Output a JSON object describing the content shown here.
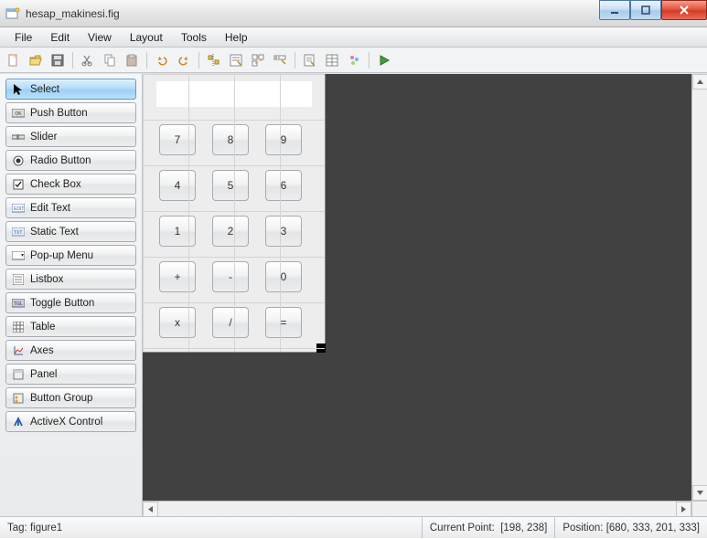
{
  "window": {
    "title": "hesap_makinesi.fig"
  },
  "menus": {
    "file": "File",
    "edit": "Edit",
    "view": "View",
    "layout": "Layout",
    "tools": "Tools",
    "help": "Help"
  },
  "palette": [
    {
      "id": "select",
      "label": "Select"
    },
    {
      "id": "pushbutton",
      "label": "Push Button"
    },
    {
      "id": "slider",
      "label": "Slider"
    },
    {
      "id": "radiobutton",
      "label": "Radio Button"
    },
    {
      "id": "checkbox",
      "label": "Check Box"
    },
    {
      "id": "edittext",
      "label": "Edit Text"
    },
    {
      "id": "statictext",
      "label": "Static Text"
    },
    {
      "id": "popupmenu",
      "label": "Pop-up Menu"
    },
    {
      "id": "listbox",
      "label": "Listbox"
    },
    {
      "id": "togglebutton",
      "label": "Toggle Button"
    },
    {
      "id": "table",
      "label": "Table"
    },
    {
      "id": "axes",
      "label": "Axes"
    },
    {
      "id": "panel",
      "label": "Panel"
    },
    {
      "id": "buttongroup",
      "label": "Button Group"
    },
    {
      "id": "activex",
      "label": "ActiveX Control"
    }
  ],
  "calc": {
    "buttons": [
      "7",
      "8",
      "9",
      "4",
      "5",
      "6",
      "1",
      "2",
      "3",
      "+",
      "-",
      "0",
      "x",
      "/",
      "="
    ]
  },
  "status": {
    "tag_label": "Tag:",
    "tag_value": "figure1",
    "curpt_label": "Current Point:",
    "curpt_value": "[198, 238]",
    "pos_label": "Position:",
    "pos_value": "[680, 333, 201, 333]"
  }
}
